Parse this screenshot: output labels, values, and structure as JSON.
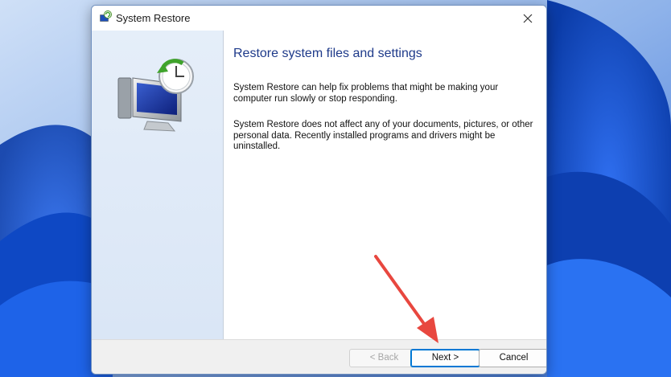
{
  "window": {
    "title": "System Restore",
    "close_icon": "close-icon",
    "app_icon": "system-restore-icon"
  },
  "content": {
    "heading": "Restore system files and settings",
    "paragraph1": "System Restore can help fix problems that might be making your computer run slowly or stop responding.",
    "paragraph2": "System Restore does not affect any of your documents, pictures, or other personal data. Recently installed programs and drivers might be uninstalled."
  },
  "buttons": {
    "back": "< Back",
    "next": "Next >",
    "cancel": "Cancel"
  },
  "colors": {
    "heading": "#1e3a8a",
    "accent": "#0078d4",
    "annotation_arrow": "#e8473f",
    "wallpaper": "#1a5fd0"
  }
}
